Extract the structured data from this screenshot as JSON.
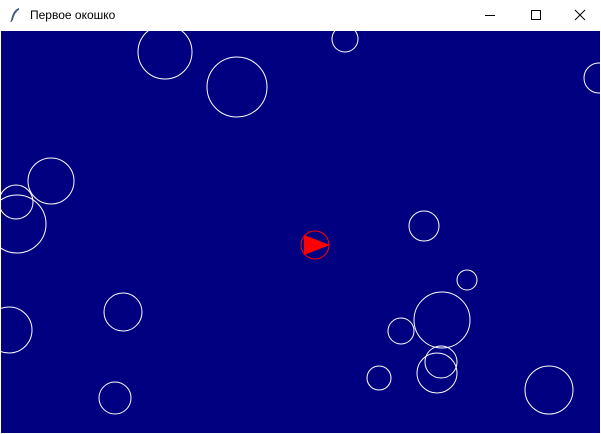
{
  "window": {
    "title": "Первое окошко",
    "icon": "feather-icon"
  },
  "controls": {
    "minimize_icon": "minimize-icon",
    "maximize_icon": "maximize-icon",
    "close_icon": "close-icon"
  },
  "colors": {
    "canvas_background": "#000080",
    "bubble_stroke": "#ffffff",
    "player_color": "#ff0000"
  }
}
